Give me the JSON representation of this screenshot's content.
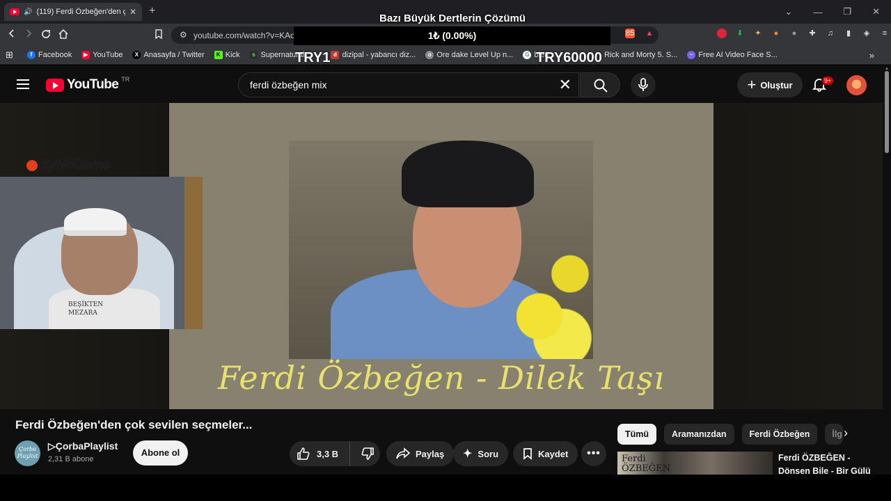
{
  "browser": {
    "tab_title": "(119) Ferdi Özbeğen'den çok",
    "address": "youtube.com/watch?v=KAo",
    "stream_title": "Bazı Büyük Dertlerin Çözümü",
    "donation_progress": "1₺ (0.00%)",
    "goal_min": "TRY1",
    "goal_max": "TRY60000",
    "brave_badge": "85",
    "bookmarks": [
      {
        "label": "Facebook",
        "icon": "facebook-icon",
        "color": "#1877f2"
      },
      {
        "label": "YouTube",
        "icon": "youtube-icon",
        "color": "#ff0033"
      },
      {
        "label": "Anasayfa / Twitter",
        "icon": "x-icon",
        "color": "#000000"
      },
      {
        "label": "Kick",
        "icon": "kick-icon",
        "color": "#53fc18"
      },
      {
        "label": "Supernatural",
        "icon": "supernatural-icon",
        "color": "#2e2e2e"
      },
      {
        "label": "dizipal - yabancı diz...",
        "icon": "dizipal-icon",
        "color": "#c0392b"
      },
      {
        "label": "Ore dake Level Up n...",
        "icon": "level-up-icon",
        "color": "#888888"
      },
      {
        "label": "blen",
        "icon": "google-icon",
        "color": "#4285f4"
      },
      {
        "label": "Rick and Morty 5. S...",
        "icon": "rick-morty-icon",
        "color": "#2e2e2e"
      },
      {
        "label": "Free AI Video Face S...",
        "icon": "face-swap-icon",
        "color": "#7b61ff"
      }
    ]
  },
  "youtube": {
    "logo_text": "YouTube",
    "logo_region": "TR",
    "search_value": "ferdi özbeğen mix",
    "create_label": "Oluştur",
    "notification_count": "9+",
    "video_caption": "Ferdi Özbeğen - Dilek Taşı",
    "watermark": "ByNoGame",
    "webcam_shirt_text": "BEŞİKTEN MEZARA",
    "video_title": "Ferdi Özbeğen'den çok sevilen seçmeler...",
    "channel_name": "▷ÇorbaPlaylist",
    "channel_avatar_text": "Çorba Playlist",
    "subscribers": "2,31 B abone",
    "subscribe_label": "Abone ol",
    "likes": "3,3 B",
    "share_label": "Paylaş",
    "ask_label": "Soru",
    "save_label": "Kaydet",
    "chips": [
      "Tümü",
      "Aramanızdan",
      "Ferdi Özbeğen",
      "İlgili"
    ],
    "recommended": {
      "thumb_text": "Ferdi ÖZBEĞEN",
      "title": "Ferdi ÖZBEĞEN - Dönsen Bile - Bir Gülü"
    }
  },
  "colors": {
    "youtube_red": "#ff0033",
    "caption_yellow": "#e9e06d",
    "bg": "#0f0f0f"
  }
}
